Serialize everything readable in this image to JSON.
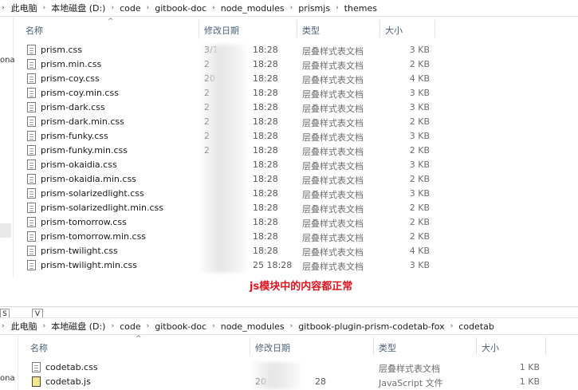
{
  "top_window": {
    "breadcrumb": [
      "此电脑",
      "本地磁盘 (D:)",
      "code",
      "gitbook-doc",
      "node_modules",
      "prismjs",
      "themes"
    ],
    "columns": {
      "name": "名称",
      "modified": "修改日期",
      "type": "类型",
      "size": "大小"
    },
    "files": [
      {
        "name": "prism.css",
        "date": "3/1",
        "time": "18:28",
        "type": "层叠样式表文档",
        "size": "3 KB"
      },
      {
        "name": "prism.min.css",
        "date": "2",
        "time": "18:28",
        "type": "层叠样式表文档",
        "size": "2 KB"
      },
      {
        "name": "prism-coy.css",
        "date": "20",
        "time": "18:28",
        "type": "层叠样式表文档",
        "size": "4 KB"
      },
      {
        "name": "prism-coy.min.css",
        "date": "2",
        "time": "18:28",
        "type": "层叠样式表文档",
        "size": "3 KB"
      },
      {
        "name": "prism-dark.css",
        "date": "2",
        "time": "18:28",
        "type": "层叠样式表文档",
        "size": "3 KB"
      },
      {
        "name": "prism-dark.min.css",
        "date": "2",
        "time": "18:28",
        "type": "层叠样式表文档",
        "size": "2 KB"
      },
      {
        "name": "prism-funky.css",
        "date": "2",
        "time": "18:28",
        "type": "层叠样式表文档",
        "size": "3 KB"
      },
      {
        "name": "prism-funky.min.css",
        "date": "2",
        "time": "18:28",
        "type": "层叠样式表文档",
        "size": "2 KB"
      },
      {
        "name": "prism-okaidia.css",
        "date": "",
        "time": "18:28",
        "type": "层叠样式表文档",
        "size": "3 KB"
      },
      {
        "name": "prism-okaidia.min.css",
        "date": "",
        "time": "18:28",
        "type": "层叠样式表文档",
        "size": "2 KB"
      },
      {
        "name": "prism-solarizedlight.css",
        "date": "",
        "time": "18:28",
        "type": "层叠样式表文档",
        "size": "3 KB"
      },
      {
        "name": "prism-solarizedlight.min.css",
        "date": "",
        "time": "18:28",
        "type": "层叠样式表文档",
        "size": "2 KB"
      },
      {
        "name": "prism-tomorrow.css",
        "date": "",
        "time": "18:28",
        "type": "层叠样式表文档",
        "size": "2 KB"
      },
      {
        "name": "prism-tomorrow.min.css",
        "date": "",
        "time": "18:28",
        "type": "层叠样式表文档",
        "size": "2 KB"
      },
      {
        "name": "prism-twilight.css",
        "date": "",
        "time": "18:28",
        "type": "层叠样式表文档",
        "size": "4 KB"
      },
      {
        "name": "prism-twilight.min.css",
        "date": "",
        "time": "25 18:28",
        "type": "层叠样式表文档",
        "size": "3 KB"
      }
    ]
  },
  "annotation": "js模块中的内容都正常",
  "bottom_window": {
    "tab_fragments": [
      "S",
      "V"
    ],
    "breadcrumb": [
      "此电脑",
      "本地磁盘 (D:)",
      "code",
      "gitbook-doc",
      "node_modules",
      "gitbook-plugin-prism-codetab-fox",
      "codetab"
    ],
    "columns": {
      "name": "名称",
      "modified": "修改日期",
      "type": "类型",
      "size": "大小"
    },
    "files": [
      {
        "name": "codetab.css",
        "date": "",
        "time": "",
        "type": "层叠样式表文档",
        "size": "1 KB",
        "icon": "css-file-icon"
      },
      {
        "name": "codetab.js",
        "date": "20",
        "time": "28",
        "type": "JavaScript 文件",
        "size": "1 KB",
        "icon": "js-file-icon"
      }
    ]
  },
  "left_fragments": [
    "ona",
    "ona"
  ],
  "colors": {
    "header_text": "#4c607a",
    "annotation": "#e0141e",
    "divider": "#e2e2e2"
  }
}
